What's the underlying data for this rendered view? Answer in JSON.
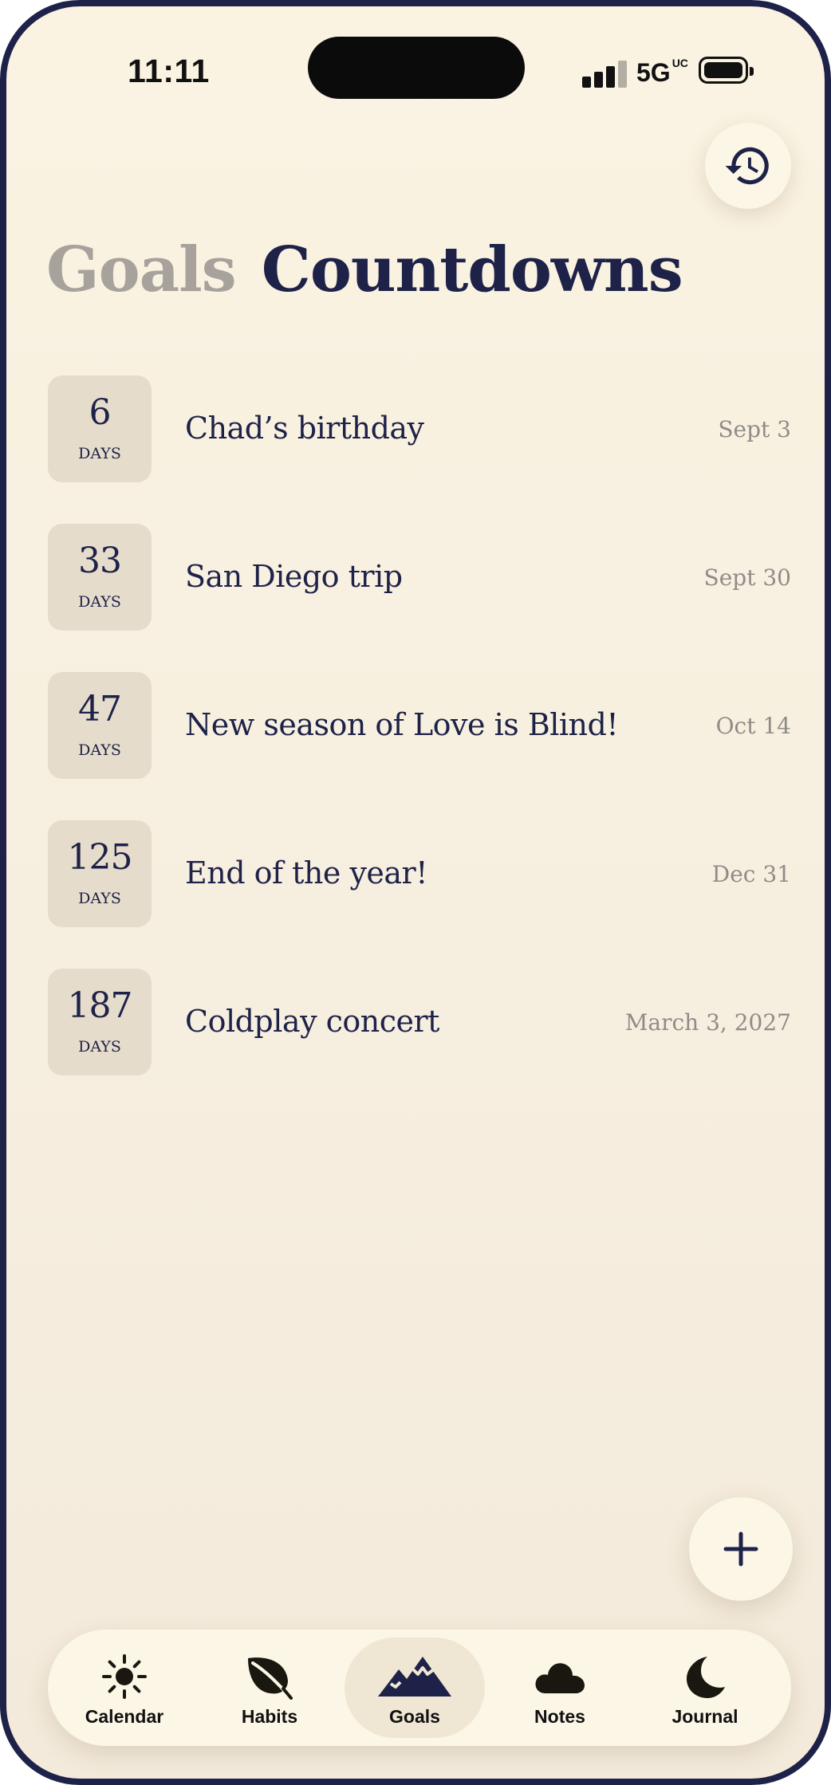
{
  "status_bar": {
    "time": "11:11",
    "carrier": "5G",
    "carrier_suffix": "UC",
    "signal_bars": 4,
    "battery_level": 1.0
  },
  "header": {
    "tab_goals": "Goals",
    "tab_countdowns": "Countdowns",
    "active_tab": "Countdowns",
    "history_icon": "history-clock-icon"
  },
  "countdowns": [
    {
      "days": "6",
      "unit": "DAYS",
      "title": "Chad’s birthday",
      "date": "Sept 3"
    },
    {
      "days": "33",
      "unit": "DAYS",
      "title": "San Diego trip",
      "date": "Sept 30"
    },
    {
      "days": "47",
      "unit": "DAYS",
      "title": "New season of Love is Blind!",
      "date": "Oct 14"
    },
    {
      "days": "125",
      "unit": "DAYS",
      "title": "End of the year!",
      "date": "Dec 31"
    },
    {
      "days": "187",
      "unit": "DAYS",
      "title": "Coldplay concert",
      "date": "March 3, 2027"
    }
  ],
  "fab": {
    "icon": "plus-icon"
  },
  "bottom_nav": {
    "active": "Goals",
    "items": [
      {
        "label": "Calendar",
        "icon": "sun-icon"
      },
      {
        "label": "Habits",
        "icon": "leaf-icon"
      },
      {
        "label": "Goals",
        "icon": "mountain-icon"
      },
      {
        "label": "Notes",
        "icon": "cloud-icon"
      },
      {
        "label": "Journal",
        "icon": "moon-icon"
      }
    ]
  },
  "colors": {
    "background": "#faf3e2",
    "primary_navy": "#1e2248",
    "badge_bg": "#e6dccb",
    "muted_text": "#8f8c88",
    "inactive_tab": "#a7a29b",
    "frame": "#1e2248"
  }
}
